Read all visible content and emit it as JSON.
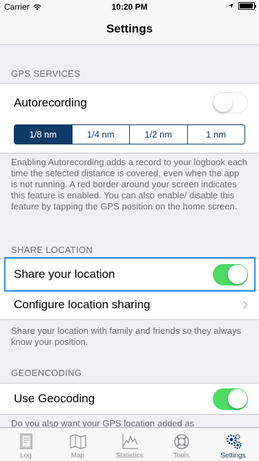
{
  "status_bar": {
    "carrier": "Carrier",
    "time": "10:20 PM",
    "battery_level": 0.95
  },
  "nav": {
    "title": "Settings"
  },
  "sections": {
    "gps": {
      "header": "GPS SERVICES",
      "autorecording_label": "Autorecording",
      "autorecording_on": false,
      "distance_options": [
        "1/8 nm",
        "1/4 nm",
        "1/2 nm",
        "1 nm"
      ],
      "selected_distance": "1/8 nm",
      "footer": "Enabling Autorecording adds a record to your logbook each time the selected distance is covered, even when the app is not running. A red border around your screen indicates this feature is enabled. You can also enable/ disable this feature by tapping the GPS position on the home screen."
    },
    "share": {
      "header": "SHARE LOCATION",
      "share_label": "Share your location",
      "share_on": true,
      "configure_label": "Configure location sharing",
      "footer": "Share your location with family and friends so they always know your position."
    },
    "geo": {
      "header": "GEOENCODING",
      "geocoding_label": "Use Geocoding",
      "geocoding_on": true,
      "footer": "Do you also want your GPS location added as"
    }
  },
  "tab_bar": {
    "tabs": [
      {
        "label": "Log",
        "icon": "logbook-icon"
      },
      {
        "label": "Map",
        "icon": "map-icon"
      },
      {
        "label": "Statistics",
        "icon": "statistics-icon"
      },
      {
        "label": "Tools",
        "icon": "life-ring-icon"
      },
      {
        "label": "Settings",
        "icon": "gears-icon"
      }
    ],
    "active": "Settings"
  },
  "colors": {
    "accent": "#0e3b66",
    "toggle_on": "#4cd964",
    "highlight": "#2e8ff0",
    "background": "#efeff4"
  }
}
